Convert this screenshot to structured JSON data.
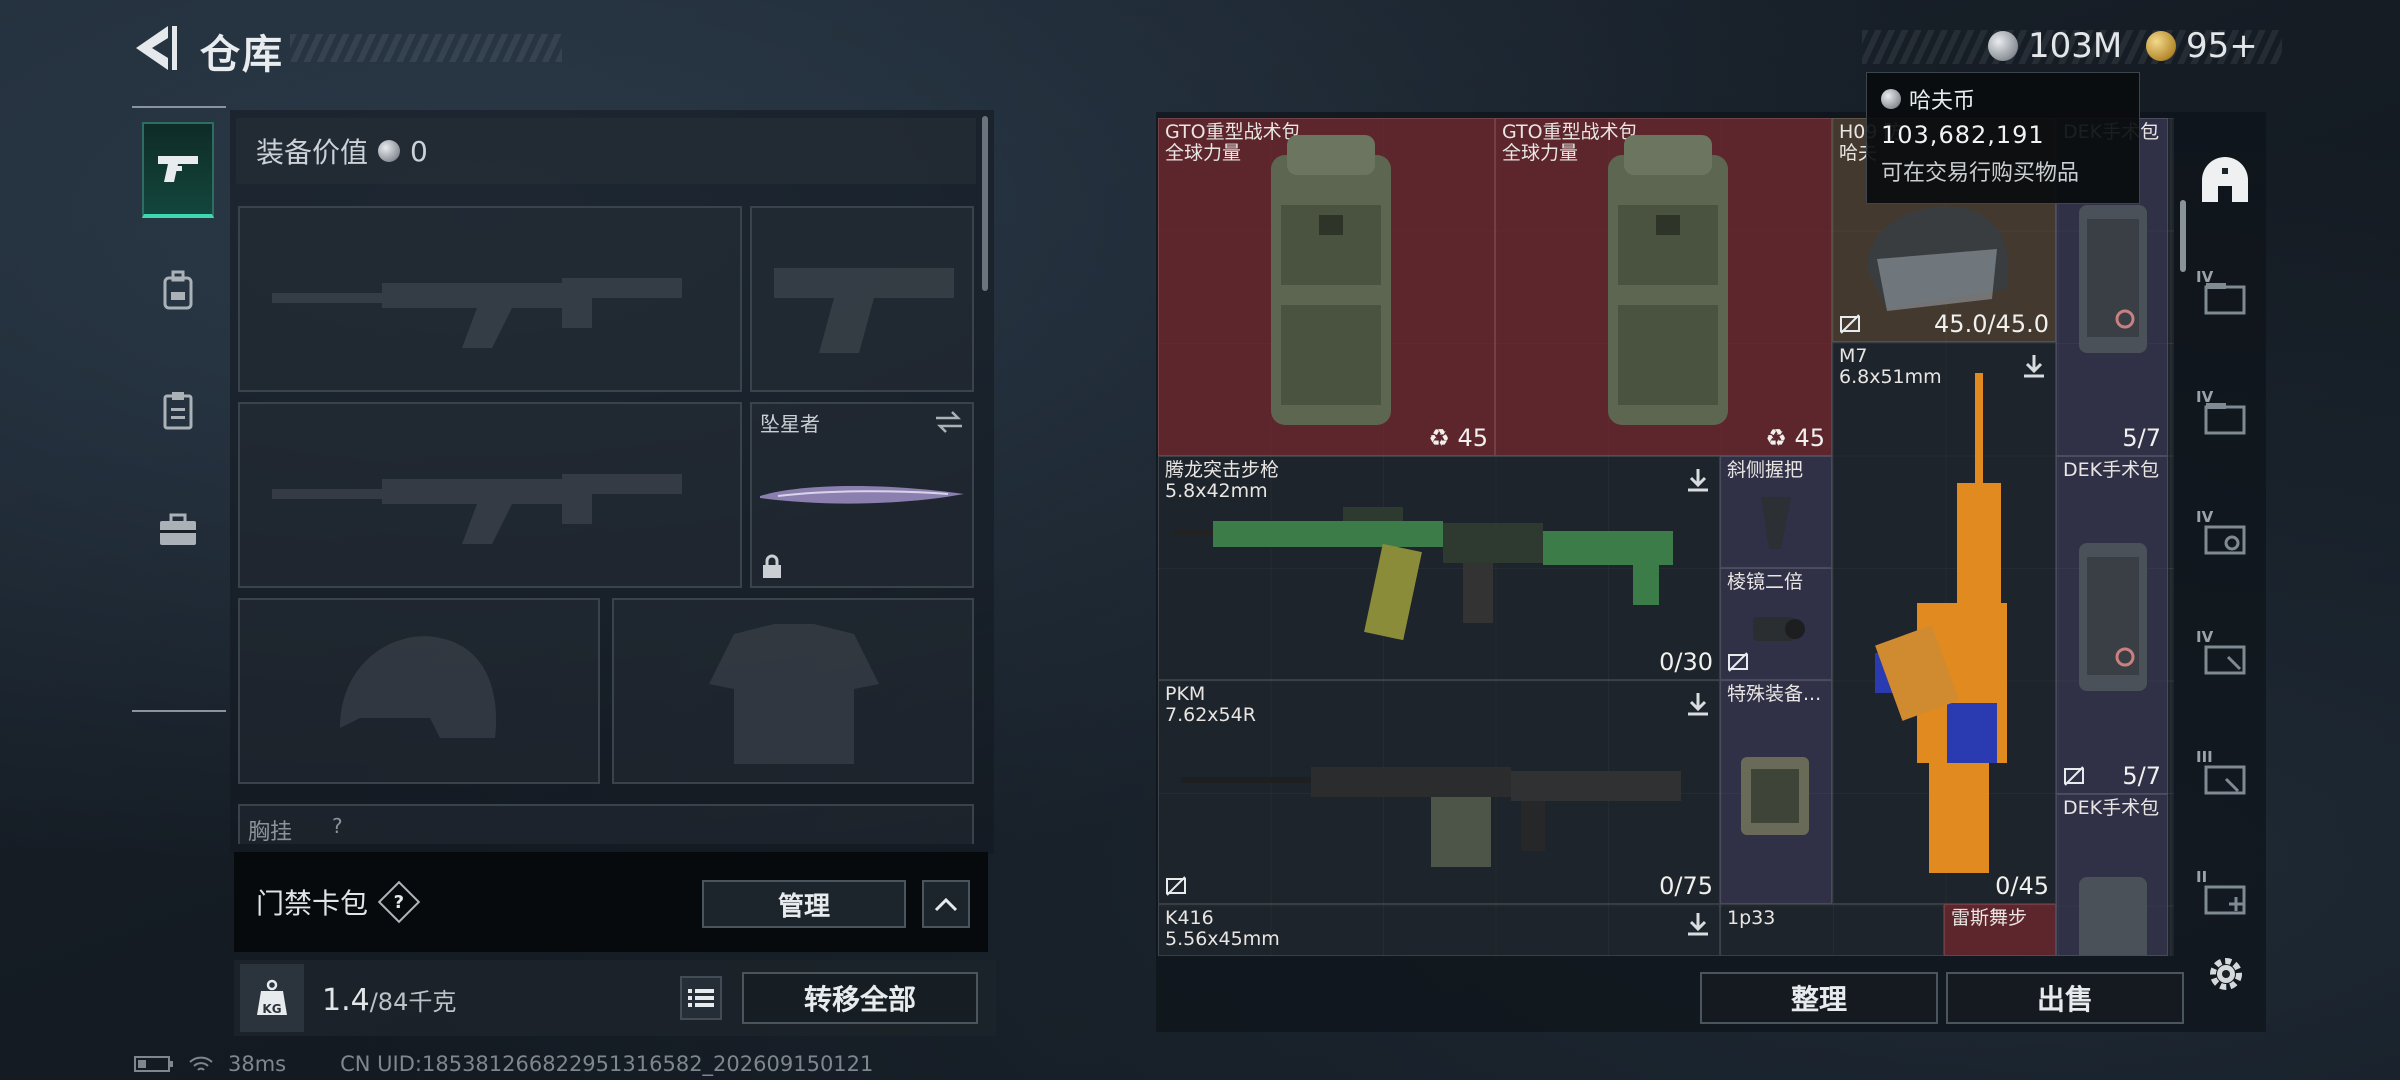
{
  "header": {
    "title": "仓库",
    "back_icon": "back-arrow-icon"
  },
  "currency": {
    "silver_amount": "103M",
    "gold_amount": "95+",
    "tooltip": {
      "title": "哈夫币",
      "amount": "103,682,191",
      "desc": "可在交易行购买物品"
    }
  },
  "left_tabs": [
    {
      "name": "pistol-icon",
      "active": true
    },
    {
      "name": "backpack-icon",
      "active": false
    },
    {
      "name": "clipboard-icon",
      "active": false
    },
    {
      "name": "toolbox-icon",
      "active": false
    }
  ],
  "equipment": {
    "value_label": "装备价值",
    "value": "0",
    "melee_label": "坠星者",
    "chest_label": "胸挂",
    "chest_hint": "?"
  },
  "card_bag": {
    "label": "门禁卡包",
    "help": "?",
    "manage_label": "管理"
  },
  "weight": {
    "current": "1.4",
    "max": "/84千克",
    "kg_label": "KG",
    "transfer_all_label": "转移全部"
  },
  "status": {
    "ping": "38ms",
    "uid": "CN UID:185381266822951316582_202609150121"
  },
  "grid_items": [
    {
      "name": "GTO重型战术包\n全球力量",
      "count": "45"
    },
    {
      "name": "GTO重型战术包\n全球力量",
      "count": "45"
    },
    {
      "name": "H09 防\n哈夫",
      "count": "45.0/45.0"
    },
    {
      "name": "DEK手术包",
      "count": "5/7"
    },
    {
      "name": "腾龙突击步枪\n5.8x42mm",
      "count": "0/30"
    },
    {
      "name": "斜侧握把",
      "count": ""
    },
    {
      "name": "M7\n6.8x51mm",
      "count": "0/45"
    },
    {
      "name": "DEK手术包",
      "count": "5/7"
    },
    {
      "name": "棱镜二倍",
      "count": ""
    },
    {
      "name": "PKM\n7.62x54R",
      "count": "0/75"
    },
    {
      "name": "特殊装备...",
      "count": ""
    },
    {
      "name": "DEK手术包",
      "count": ""
    },
    {
      "name": "K416\n5.56x45mm",
      "count": ""
    },
    {
      "name": "1p33",
      "count": ""
    },
    {
      "name": "雷斯舞步",
      "count": ""
    }
  ],
  "side_rail": {
    "tiers": [
      "IV",
      "IV",
      "IV",
      "IV",
      "III",
      "II"
    ]
  },
  "actions": {
    "sort_label": "整理",
    "sell_label": "出售"
  },
  "colors": {
    "accent": "#3fd7b1",
    "red_item": "#73262e",
    "purple_item": "#3a3956"
  }
}
